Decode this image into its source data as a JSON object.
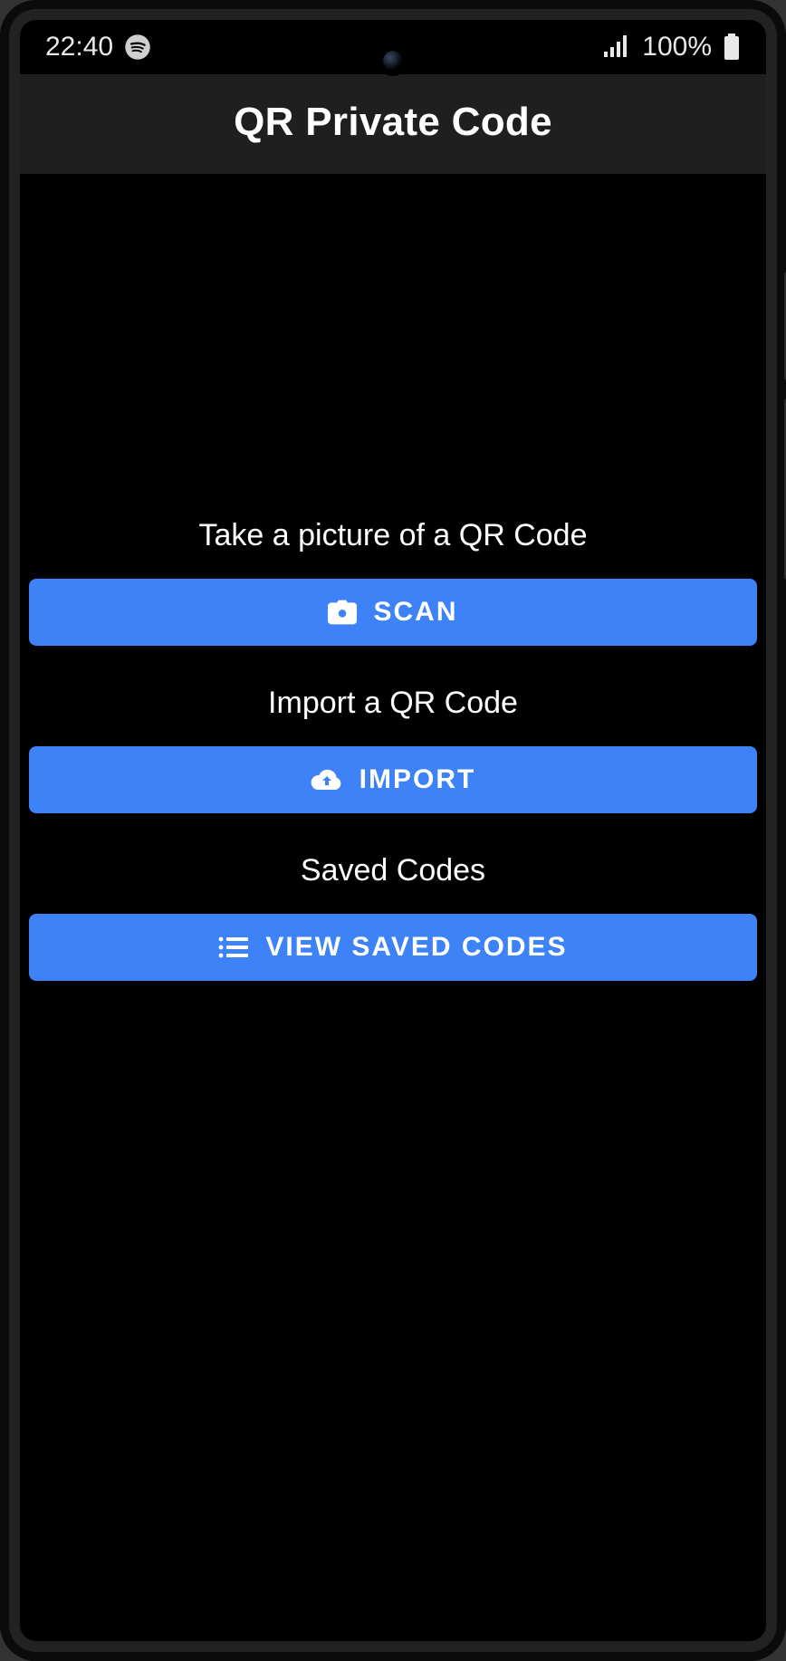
{
  "statusbar": {
    "time": "22:40",
    "battery_pct": "100%"
  },
  "appbar": {
    "title": "QR Private Code"
  },
  "sections": {
    "scan_label": "Take a picture of a QR Code",
    "scan_button": "SCAN",
    "import_label": "Import a QR Code",
    "import_button": "IMPORT",
    "saved_label": "Saved Codes",
    "saved_button": "VIEW SAVED CODES"
  },
  "colors": {
    "accent": "#3d82f7",
    "appbar_bg": "#1f1f1f",
    "background": "#000000",
    "text": "#ffffff"
  },
  "icons": {
    "status_left": "spotify-icon",
    "status_signal": "signal-icon",
    "status_battery": "battery-icon",
    "scan": "camera-icon",
    "import": "cloud-upload-icon",
    "saved": "list-icon"
  }
}
